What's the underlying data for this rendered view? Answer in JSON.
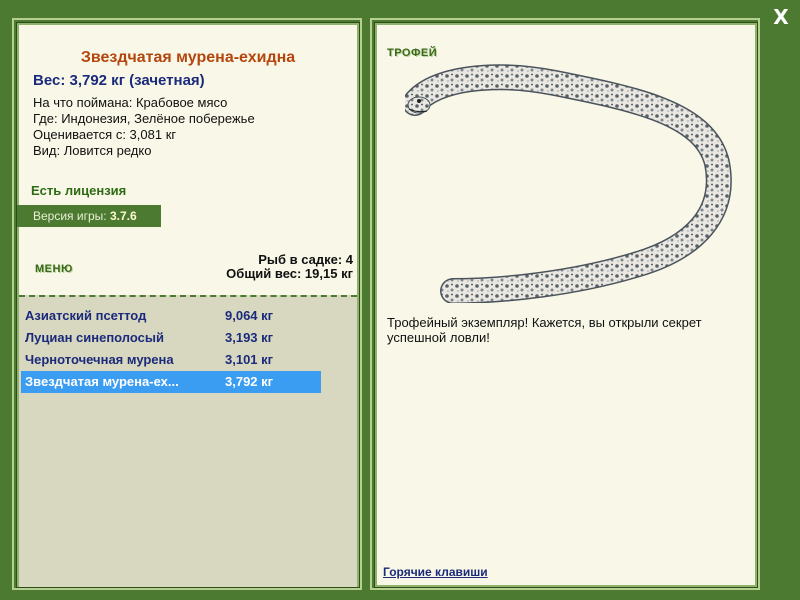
{
  "window": {
    "close_glyph": "X"
  },
  "fish": {
    "title": "Звездчатая мурена-ехидна",
    "weight": "Вес: 3,792 кг (зачетная)",
    "bait": "На что поймана: Крабовое мясо",
    "place": "Где: Индонезия, Зелёное побережье",
    "price": "Оценивается с: 3,081 кг",
    "kind": "Вид: Ловится редко"
  },
  "license": "Есть лицензия",
  "version": {
    "label": "Версия игры: ",
    "number": "3.7.6"
  },
  "menu_label": "МЕНЮ",
  "keepnet": {
    "count": "Рыб в садке: 4",
    "total": "Общий вес: 19,15 кг"
  },
  "catch_list": [
    {
      "name": "Азиатский псеттод",
      "weight": "9,064 кг"
    },
    {
      "name": "Луциан синеполосый",
      "weight": "3,193 кг"
    },
    {
      "name": "Черноточечная мурена",
      "weight": "3,101 кг"
    },
    {
      "name": "Звездчатая мурена-ех...",
      "weight": "3,792 кг"
    }
  ],
  "trophy": {
    "label": "ТРОФЕЙ",
    "text": "Трофейный экземпляр! Кажется, вы открыли секрет успешной ловли!",
    "image_icon": "moray-eel-image"
  },
  "hotkeys_link": "Горячие клавиши",
  "colors": {
    "background": "#4d7a31",
    "panel": "#f9f8e8",
    "title": "#b4460d",
    "accent_text": "#1b2a7a",
    "selection": "#3b9df2"
  }
}
